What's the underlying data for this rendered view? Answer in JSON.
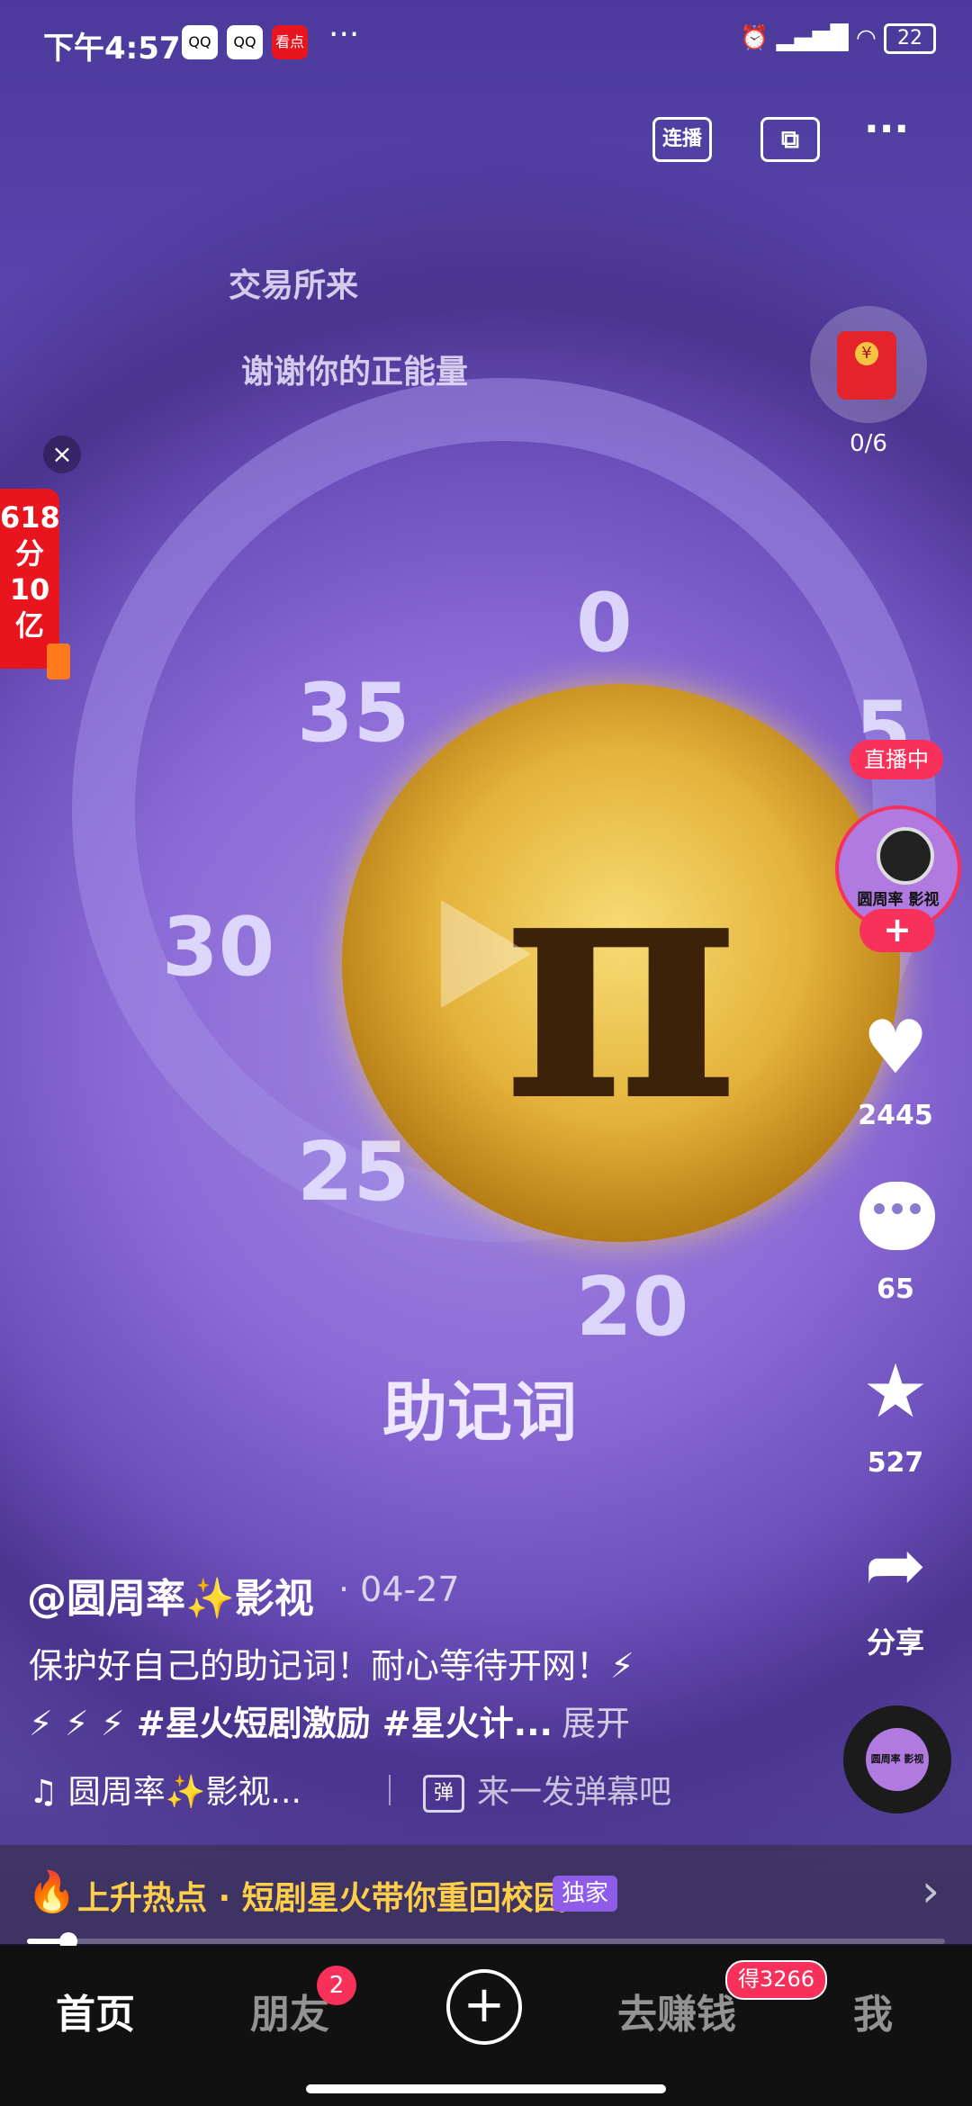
{
  "status_bar": {
    "time": "下午4:57",
    "app_icons": [
      "QQ",
      "QQ",
      "看点"
    ],
    "more": "···",
    "battery": "22"
  },
  "top_bar": {
    "connect_label": "连播",
    "cast_icon": "screen-cast-icon",
    "more": "···"
  },
  "video": {
    "captions": [
      "交易所来",
      "谢谢你的正能量",
      "助记词"
    ],
    "dial_numbers": [
      "0",
      "5",
      "35",
      "30",
      "25",
      "20"
    ],
    "coin_symbol": "π"
  },
  "promo": {
    "lines": [
      "618",
      "分",
      "10",
      "亿"
    ],
    "close": "×"
  },
  "red_packet": {
    "count": "0/6"
  },
  "creator": {
    "live_label": "直播中",
    "avatar_text": "圆周率 影视",
    "follow": "+"
  },
  "actions": {
    "likes": "2445",
    "comments": "65",
    "favorites": "527",
    "share_label": "分享"
  },
  "post": {
    "author": "@圆周率✨影视",
    "date": "· 04-27",
    "description_line1": "保护好自己的助记词！耐心等待开网！⚡",
    "description_line2": "⚡ ⚡ ⚡ #星火短剧激励 #星火计...",
    "expand": "展开",
    "music": "圆周率✨影视...",
    "danmu_icon": "弹",
    "danmu_placeholder": "来一发弹幕吧"
  },
  "hot_banner": {
    "text": "上升热点 · 短剧星火带你重回校园",
    "tag": "独家"
  },
  "progress": {
    "fraction": 0.045
  },
  "tabbar": {
    "home": "首页",
    "friends": "朋友",
    "friends_badge": "2",
    "plus": "+",
    "earn": "去赚钱",
    "earn_badge": "得3266",
    "me": "我"
  },
  "colors": {
    "accent_red": "#f8315b",
    "hot_yellow": "#ffcf4a",
    "tag_purple": "#8e5ce8"
  }
}
